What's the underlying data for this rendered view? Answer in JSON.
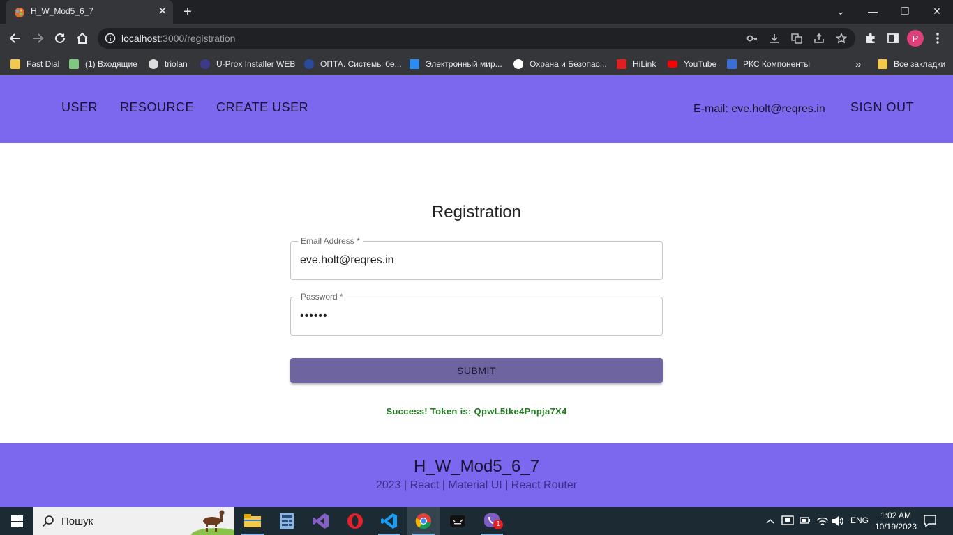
{
  "browser": {
    "tab_title": "H_W_Mod5_6_7",
    "close_glyph": "✕",
    "new_tab_glyph": "+",
    "url_host": "localhost",
    "url_path": ":3000/registration",
    "window_controls": {
      "minimize": "—",
      "maximize": "❐",
      "close": "✕",
      "tabsearch": "⌄"
    },
    "profile_initial": "P",
    "bookmarks": [
      {
        "label": "Fast Dial",
        "icon": "folder-icon",
        "color": "#f2c94c"
      },
      {
        "label": "(1) Входящие",
        "icon": "mail-icon",
        "color": "#7fc97f"
      },
      {
        "label": "triolan",
        "icon": "globe-icon",
        "color": "#dddddd"
      },
      {
        "label": "U-Prox Installer WEB",
        "icon": "uprox-icon",
        "color": "#3b3b8a"
      },
      {
        "label": "ОПТА. Системы бе...",
        "icon": "opta-icon",
        "color": "#2a4a9a"
      },
      {
        "label": "Электронный мир...",
        "icon": "e-icon",
        "color": "#2d8cf0"
      },
      {
        "label": "Охрана и Безопас...",
        "icon": "eye-icon",
        "color": "#ffffff"
      },
      {
        "label": "HiLink",
        "icon": "huawei-icon",
        "color": "#e02020"
      },
      {
        "label": "YouTube",
        "icon": "youtube-icon",
        "color": "#ff0000"
      },
      {
        "label": "РКС Компоненты",
        "icon": "signal-icon",
        "color": "#3b6fd4"
      }
    ],
    "bookmarks_overflow": "»",
    "all_bookmarks": "Все закладки"
  },
  "app": {
    "nav": [
      "USER",
      "RESOURCE",
      "CREATE USER"
    ],
    "email_label": "E-mail: eve.holt@reqres.in",
    "sign_out": "SIGN OUT",
    "form": {
      "title": "Registration",
      "email_label": "Email Address *",
      "email_value": "eve.holt@reqres.in",
      "password_label": "Password *",
      "password_value": "••••••",
      "submit": "SUBMIT",
      "success": "Success! Token is: QpwL5tke4Pnpja7X4"
    },
    "footer": {
      "title": "H_W_Mod5_6_7",
      "subtitle": "2023 | React | Material UI | React Router"
    },
    "colors": {
      "accent": "#7b68ee",
      "button": "#6e64a0",
      "success": "#1e7b1e"
    }
  },
  "taskbar": {
    "search_text": "Пошук",
    "language": "ENG",
    "time": "1:02 AM",
    "date": "10/19/2023",
    "viber_badge": "1"
  }
}
